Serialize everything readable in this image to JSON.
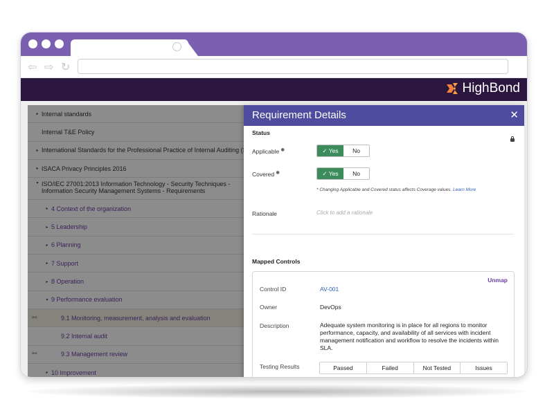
{
  "brand": {
    "name": "HighBond",
    "accent": "#f0813a"
  },
  "colors": {
    "titlebar": "#7b5fb0",
    "appbar": "#2b1640",
    "panel_header": "#4f4b9e",
    "yes_green": "#3b8c5a",
    "link": "#6b3fa0"
  },
  "browser": {
    "back_icon": "arrow-left-icon",
    "forward_icon": "arrow-right-icon",
    "reload_icon": "reload-icon"
  },
  "tree": [
    {
      "label": "Internal standards",
      "caret": "▸",
      "level": 0
    },
    {
      "label": "Internal T&E Policy",
      "caret": "",
      "level": 0
    },
    {
      "label": "International Standards for the Professional Practice of Internal Auditing (Standards)",
      "caret": "▸",
      "level": 0
    },
    {
      "label": "ISACA Privacy Principles 2016",
      "caret": "▸",
      "level": 0
    },
    {
      "label": "ISO/IEC 27001:2013 Information Technology - Security Techniques - Information Security Management Systems - Requirements",
      "caret": "▾",
      "level": 0
    },
    {
      "label": "4  Context of the organization",
      "caret": "▸",
      "level": 1
    },
    {
      "label": "5  Leadership",
      "caret": "▸",
      "level": 1
    },
    {
      "label": "6  Planning",
      "caret": "▸",
      "level": 1
    },
    {
      "label": "7  Support",
      "caret": "▸",
      "level": 1
    },
    {
      "label": "8  Operation",
      "caret": "▸",
      "level": 1
    },
    {
      "label": "9  Performance evaluation",
      "caret": "▾",
      "level": 1
    },
    {
      "label": "9.1  Monitoring, measurement, analysis and evaluation",
      "caret": "",
      "level": 2
    },
    {
      "label": "9.2  Internal audit",
      "caret": "",
      "level": 2
    },
    {
      "label": "9.3  Management review",
      "caret": "",
      "level": 2
    },
    {
      "label": "10  Improvement",
      "caret": "▸",
      "level": 1
    }
  ],
  "panel": {
    "title": "Requirement Details",
    "close": "✕",
    "status_heading": "Status",
    "applicable_label": "Applicable",
    "covered_label": "Covered",
    "yes": "✓ Yes",
    "no": "No",
    "note": "* Changing Applicable and Covered status affects Coverage values.",
    "learn_more": "Learn More",
    "rationale_label": "Rationale",
    "rationale_placeholder": "Click to add a rationale",
    "mapped_heading": "Mapped Controls",
    "unmap": "Unmap",
    "control_id_label": "Control ID",
    "control_id": "AV-001",
    "owner_label": "Owner",
    "owner": "DevOps",
    "description_label": "Description",
    "description": "Adequate system monitoring is in place for all regions to monitor performance, capacity, and availability of all services with incident management notification and workflow to resolve the incidents within SLA.",
    "testing_label": "Testing Results",
    "results": [
      "Passed",
      "Failed",
      "Not Tested",
      "Issues"
    ]
  }
}
